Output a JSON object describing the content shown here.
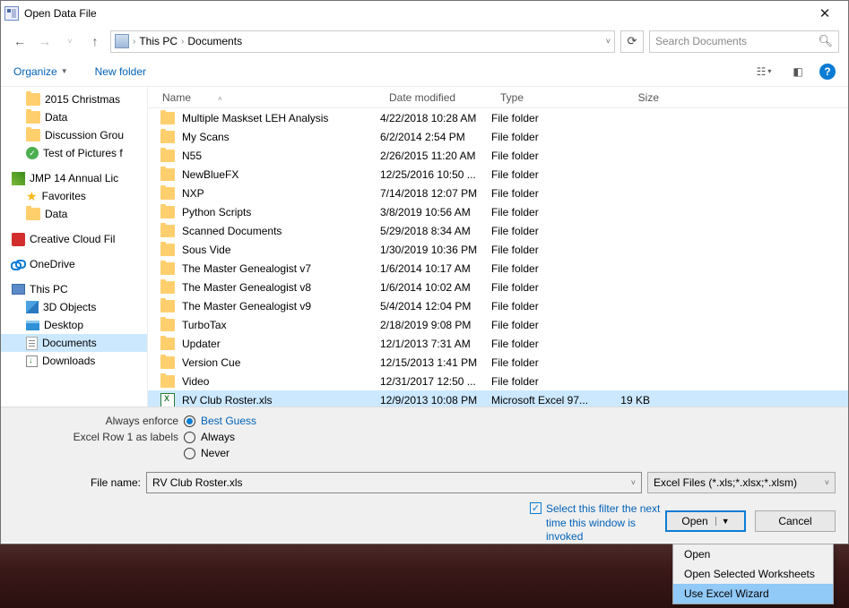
{
  "window": {
    "title": "Open Data File"
  },
  "nav": {
    "path": [
      "This PC",
      "Documents"
    ],
    "search_placeholder": "Search Documents"
  },
  "toolbar": {
    "organize": "Organize",
    "newfolder": "New folder"
  },
  "tree": [
    {
      "icon": "folder",
      "label": "2015 Christmas",
      "sub": true
    },
    {
      "icon": "folder",
      "label": "Data",
      "sub": true
    },
    {
      "icon": "folder",
      "label": "Discussion Grou",
      "sub": true
    },
    {
      "icon": "greencheck",
      "label": "Test of Pictures f",
      "sub": true
    },
    {
      "icon": "jmp",
      "label": "JMP 14 Annual Lic",
      "sub": false,
      "gap": true
    },
    {
      "icon": "star",
      "label": "Favorites",
      "sub": true
    },
    {
      "icon": "folder",
      "label": "Data",
      "sub": true
    },
    {
      "icon": "cc",
      "label": "Creative Cloud Fil",
      "sub": false,
      "gap": true
    },
    {
      "icon": "od",
      "label": "OneDrive",
      "sub": false,
      "gap": true
    },
    {
      "icon": "pc",
      "label": "This PC",
      "sub": false,
      "gap": true
    },
    {
      "icon": "obj3d",
      "label": "3D Objects",
      "sub": true
    },
    {
      "icon": "desk",
      "label": "Desktop",
      "sub": true
    },
    {
      "icon": "doc",
      "label": "Documents",
      "sub": true,
      "selected": true
    },
    {
      "icon": "dl",
      "label": "Downloads",
      "sub": true
    }
  ],
  "columns": {
    "name": "Name",
    "date": "Date modified",
    "type": "Type",
    "size": "Size"
  },
  "files": [
    {
      "name": "Multiple Maskset LEH Analysis",
      "date": "4/22/2018 10:28 AM",
      "type": "File folder",
      "size": "",
      "kind": "folder"
    },
    {
      "name": "My Scans",
      "date": "6/2/2014 2:54 PM",
      "type": "File folder",
      "size": "",
      "kind": "folder"
    },
    {
      "name": "N55",
      "date": "2/26/2015 11:20 AM",
      "type": "File folder",
      "size": "",
      "kind": "folder"
    },
    {
      "name": "NewBlueFX",
      "date": "12/25/2016 10:50 ...",
      "type": "File folder",
      "size": "",
      "kind": "folder"
    },
    {
      "name": "NXP",
      "date": "7/14/2018 12:07 PM",
      "type": "File folder",
      "size": "",
      "kind": "folder"
    },
    {
      "name": "Python Scripts",
      "date": "3/8/2019 10:56 AM",
      "type": "File folder",
      "size": "",
      "kind": "folder"
    },
    {
      "name": "Scanned Documents",
      "date": "5/29/2018 8:34 AM",
      "type": "File folder",
      "size": "",
      "kind": "folder"
    },
    {
      "name": "Sous Vide",
      "date": "1/30/2019 10:36 PM",
      "type": "File folder",
      "size": "",
      "kind": "folder"
    },
    {
      "name": "The Master Genealogist v7",
      "date": "1/6/2014 10:17 AM",
      "type": "File folder",
      "size": "",
      "kind": "folder"
    },
    {
      "name": "The Master Genealogist v8",
      "date": "1/6/2014 10:02 AM",
      "type": "File folder",
      "size": "",
      "kind": "folder"
    },
    {
      "name": "The Master Genealogist v9",
      "date": "5/4/2014 12:04 PM",
      "type": "File folder",
      "size": "",
      "kind": "folder"
    },
    {
      "name": "TurboTax",
      "date": "2/18/2019 9:08 PM",
      "type": "File folder",
      "size": "",
      "kind": "folder"
    },
    {
      "name": "Updater",
      "date": "12/1/2013 7:31 AM",
      "type": "File folder",
      "size": "",
      "kind": "folder"
    },
    {
      "name": "Version Cue",
      "date": "12/15/2013 1:41 PM",
      "type": "File folder",
      "size": "",
      "kind": "folder"
    },
    {
      "name": "Video",
      "date": "12/31/2017 12:50 ...",
      "type": "File folder",
      "size": "",
      "kind": "folder"
    },
    {
      "name": "RV Club Roster.xls",
      "date": "12/9/2013 10:08 PM",
      "type": "Microsoft Excel 97...",
      "size": "19 KB",
      "kind": "xls",
      "selected": true
    }
  ],
  "options": {
    "enforce_label": "Always enforce",
    "row1_label": "Excel Row 1 as labels",
    "radios": {
      "best": "Best Guess",
      "always": "Always",
      "never": "Never"
    },
    "radio_selected": "best",
    "filename_label": "File name:",
    "filename_value": "RV Club Roster.xls",
    "filetype": "Excel Files  (*.xls;*.xlsx;*.xlsm)",
    "filter_check": "Select this filter the next time this window is invoked",
    "open": "Open",
    "cancel": "Cancel"
  },
  "dropdown": [
    "Open",
    "Open Selected Worksheets",
    "Use Excel Wizard"
  ],
  "dropdown_highlight": 2
}
